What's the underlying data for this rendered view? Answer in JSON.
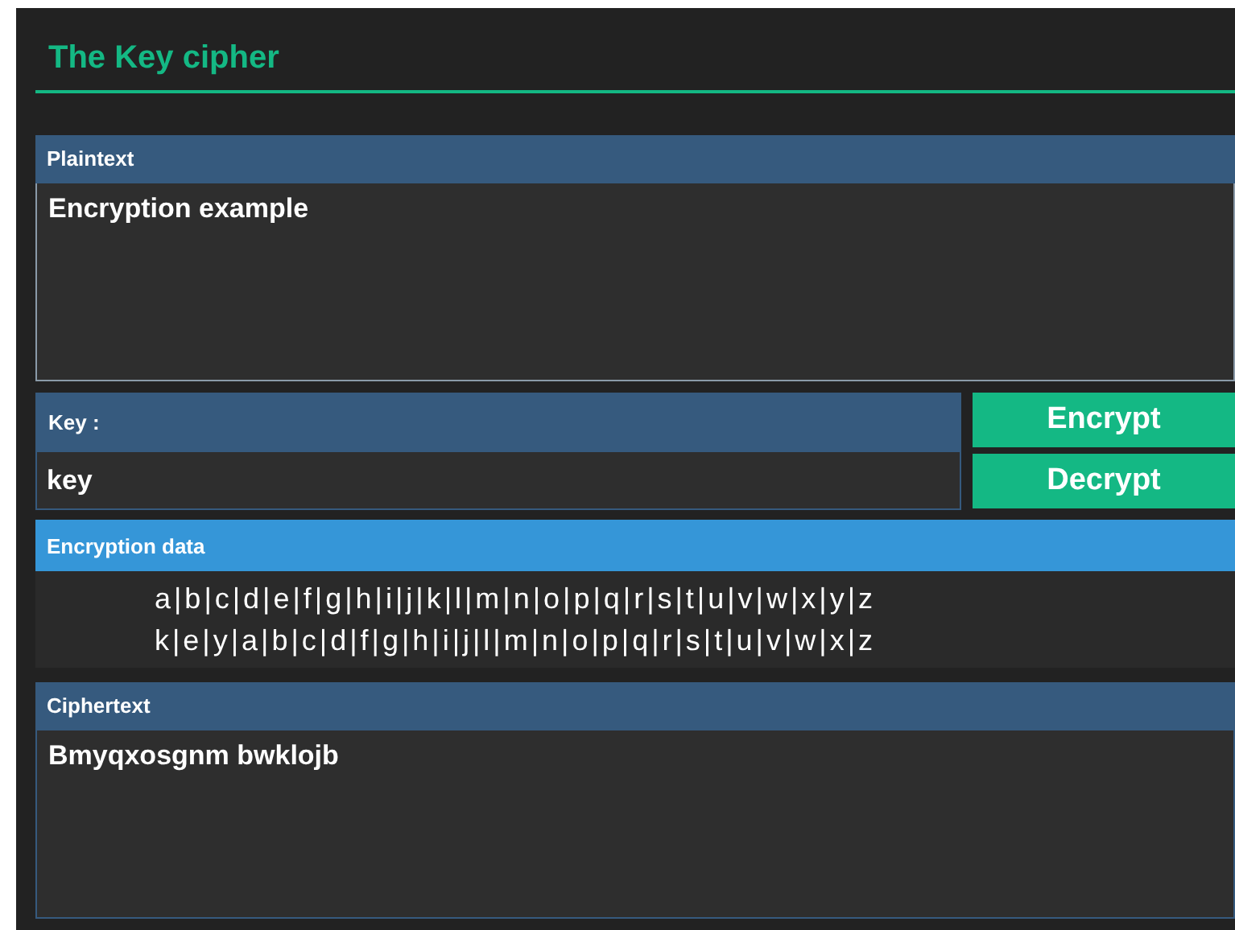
{
  "title": "The Key cipher",
  "plaintext": {
    "label": "Plaintext",
    "value": "Encryption example"
  },
  "key": {
    "label": "Key :",
    "value": "key"
  },
  "buttons": [
    {
      "label": "Encrypt"
    },
    {
      "label": "Decrypt"
    }
  ],
  "encryption_data": {
    "label": "Encryption data",
    "rows": [
      "a|b|c|d|e|f|g|h|i|j|k|l|m|n|o|p|q|r|s|t|u|v|w|x|y|z",
      "k|e|y|a|b|c|d|f|g|h|i|j|l|m|n|o|p|q|r|s|t|u|v|w|x|z"
    ]
  },
  "ciphertext": {
    "label": "Ciphertext",
    "value": "Bmyqxosgnm bwklojb"
  }
}
